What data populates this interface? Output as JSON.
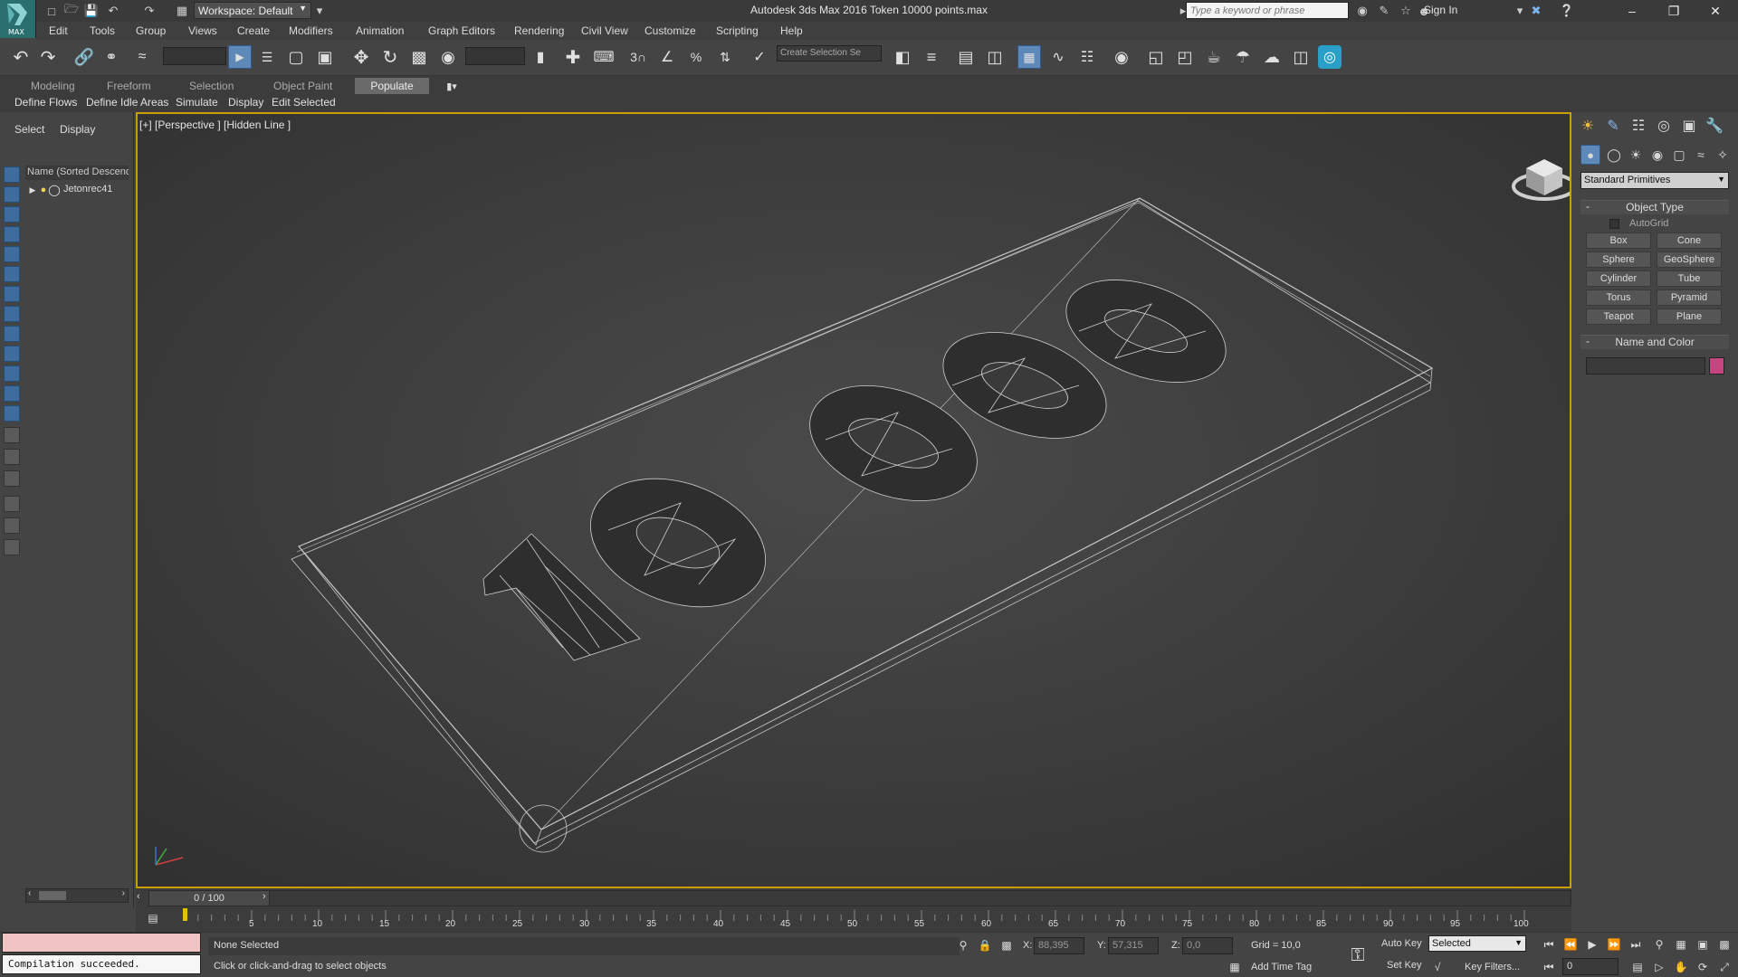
{
  "app": {
    "logo_label": "MAX",
    "workspace": "Workspace: Default",
    "title": "Autodesk 3ds Max 2016    Token 10000 points.max",
    "search_placeholder": "Type a keyword or phrase",
    "sign_in": "Sign In"
  },
  "menu": [
    "Edit",
    "Tools",
    "Group",
    "Views",
    "Create",
    "Modifiers",
    "Animation",
    "Graph Editors",
    "Rendering",
    "Civil View",
    "Customize",
    "Scripting",
    "Help"
  ],
  "toolbar": {
    "selection_set_placeholder": "Create Selection Se"
  },
  "ribbon": {
    "tabs": [
      "Modeling",
      "Freeform",
      "Selection",
      "Object Paint",
      "Populate"
    ],
    "active_tab": "Populate",
    "subtabs": [
      "Define Flows",
      "Define Idle Areas",
      "Simulate",
      "Display",
      "Edit Selected"
    ]
  },
  "explorer": {
    "tabs": [
      "Select",
      "Display"
    ],
    "column_header": "Name (Sorted Descending)",
    "items": [
      {
        "name": "Jetonrec41"
      }
    ]
  },
  "viewport": {
    "label": "[+] [Perspective ] [Hidden Line ]",
    "token_text": "10000"
  },
  "command_panel": {
    "dropdown": "Standard Primitives",
    "object_type_title": "Object Type",
    "autogrid": "AutoGrid",
    "primitives": [
      "Box",
      "Cone",
      "Sphere",
      "GeoSphere",
      "Cylinder",
      "Tube",
      "Torus",
      "Pyramid",
      "Teapot",
      "Plane"
    ],
    "name_color_title": "Name and Color",
    "color": "#c4457f"
  },
  "timeline": {
    "frame_display": "0 / 100",
    "ticks": [
      "5",
      "10",
      "15",
      "20",
      "25",
      "30",
      "35",
      "40",
      "45",
      "50",
      "55",
      "60",
      "65",
      "70",
      "75",
      "80",
      "85",
      "90",
      "95",
      "100"
    ]
  },
  "status": {
    "maxscript_output": "Compilation succeeded.",
    "selection": "None Selected",
    "prompt": "Click or click-and-drag to select objects",
    "x_label": "X:",
    "x_value": "88,395",
    "y_label": "Y:",
    "y_value": "57,315",
    "z_label": "Z:",
    "z_value": "0,0",
    "grid": "Grid = 10,0",
    "add_time_tag": "Add Time Tag",
    "auto_key": "Auto Key",
    "set_key": "Set Key",
    "key_mode": "Selected",
    "key_filters": "Key Filters...",
    "frame": "0"
  }
}
